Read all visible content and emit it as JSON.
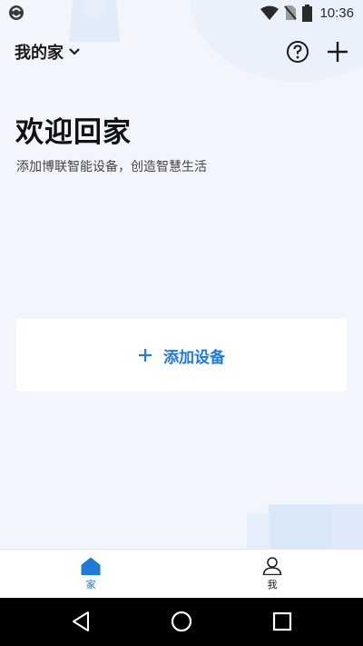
{
  "status_bar": {
    "time": "10:36",
    "icons": [
      "app-notification-icon",
      "wifi-icon",
      "no-sim-icon",
      "battery-icon"
    ]
  },
  "header": {
    "home_name": "我的家",
    "icons": [
      "chevron-down-icon",
      "help-icon",
      "plus-icon"
    ]
  },
  "welcome": {
    "title": "欢迎回家",
    "subtitle": "添加博联智能设备，创造智慧生活"
  },
  "add_device": {
    "label": "添加设备",
    "icon": "plus-icon"
  },
  "tabs": [
    {
      "label": "家",
      "icon": "home-icon",
      "active": true
    },
    {
      "label": "我",
      "icon": "user-icon",
      "active": false
    }
  ],
  "nav_bar": {
    "buttons": [
      "back-icon",
      "home-circle-icon",
      "recents-icon"
    ]
  },
  "colors": {
    "accent": "#1e7bd7",
    "background": "#f2f6fc",
    "card": "#ffffff",
    "nav_bar": "#000000"
  }
}
